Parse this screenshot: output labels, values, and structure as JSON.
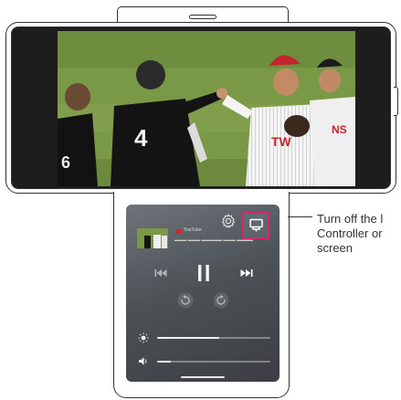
{
  "callout": {
    "text": "Turn off the l\nController or\nscreen"
  },
  "now_playing": {
    "source": "YouTube",
    "title": "▬▬▬ ▬▬▬ ▬▬▬▬▬ ▬▬▬ ▬▬▬▬"
  },
  "controls": {
    "brightness_level": 0.55,
    "volume_level": 0.12
  },
  "colors": {
    "highlight": "#cc2c6c",
    "field": "#7e9c48",
    "uniform_dark": "#111111"
  },
  "icons": {
    "settings": "gear-icon",
    "controller_toggle": "controller-off-icon",
    "previous": "skip-previous-icon",
    "pause": "pause-icon",
    "next": "skip-next-icon",
    "rewind": "replay-icon",
    "forward": "forward-icon",
    "brightness": "brightness-icon",
    "volume": "volume-icon"
  }
}
